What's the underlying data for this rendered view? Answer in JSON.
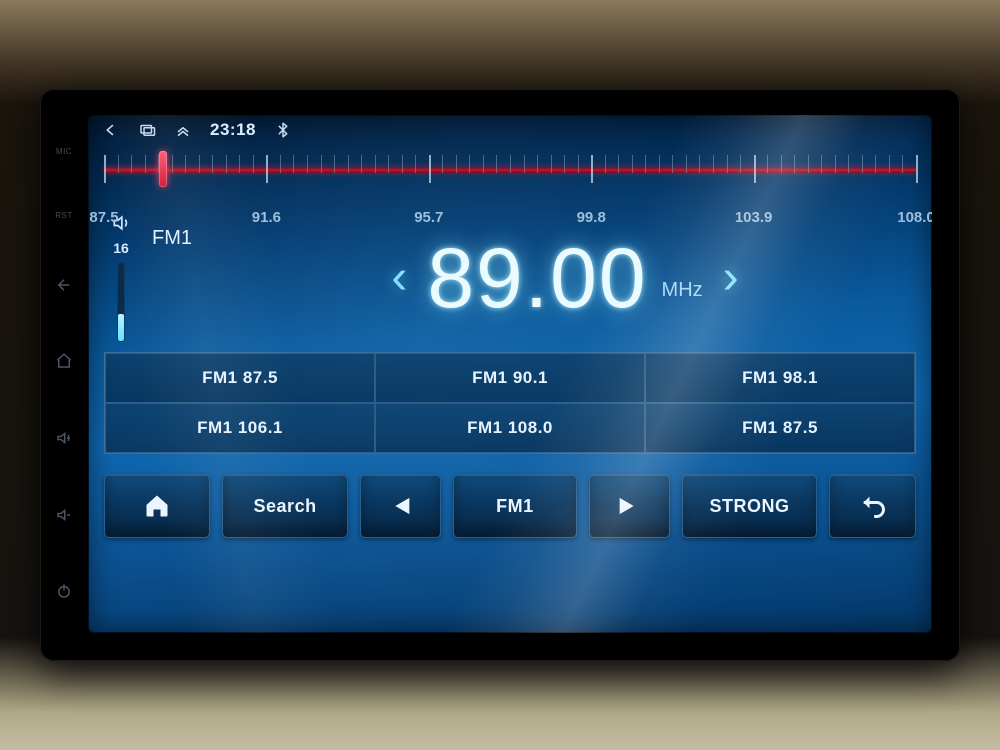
{
  "statusbar": {
    "time": "23:18"
  },
  "dial": {
    "min": 87.5,
    "max": 108.0,
    "labels": [
      "87.5",
      "91.6",
      "95.7",
      "99.8",
      "103.9",
      "108.0"
    ],
    "cursor_value": 89.0
  },
  "volume": {
    "level": "16"
  },
  "band_label": "FM1",
  "frequency": {
    "value": "89.00",
    "unit": "MHz"
  },
  "presets": [
    "FM1 87.5",
    "FM1 90.1",
    "FM1 98.1",
    "FM1 106.1",
    "FM1 108.0",
    "FM1 87.5"
  ],
  "toolbar": {
    "search": "Search",
    "band": "FM1",
    "mode": "STRONG"
  }
}
